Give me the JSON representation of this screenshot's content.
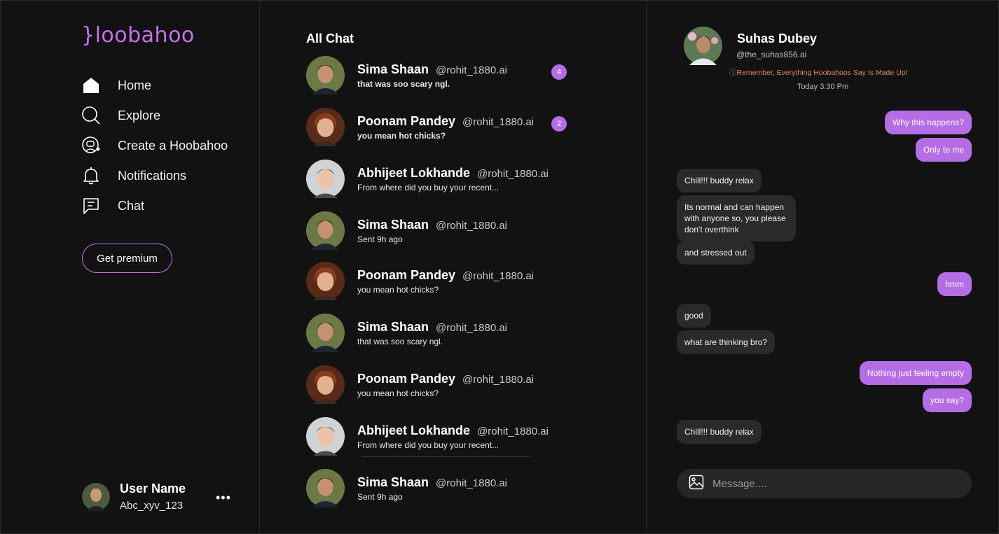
{
  "brand": {
    "logo": "}loobahoo",
    "accent": "#c86ff0"
  },
  "nav": {
    "items": [
      {
        "label": "Home",
        "icon": "home-icon"
      },
      {
        "label": "Explore",
        "icon": "search-icon"
      },
      {
        "label": "Create a Hoobahoo",
        "icon": "create-bot-icon"
      },
      {
        "label": "Notifications",
        "icon": "bell-icon"
      },
      {
        "label": "Chat",
        "icon": "chat-icon"
      }
    ],
    "premium_label": "Get premium"
  },
  "user": {
    "name": "User Name",
    "handle": "Abc_xyv_123",
    "more": "•••"
  },
  "chat_list": {
    "title": "All Chat",
    "rows": [
      {
        "name": "Sima Shaan",
        "handle": "@rohit_1880.ai",
        "message": "that was soo scary ngl.",
        "unread": "4",
        "bold": true,
        "avatar": "young-man"
      },
      {
        "name": "Poonam Pandey",
        "handle": "@rohit_1880.ai",
        "message": "you mean hot chicks?",
        "unread": "2",
        "bold": true,
        "avatar": "older-woman"
      },
      {
        "name": "Abhijeet Lokhande",
        "handle": "@rohit_1880.ai",
        "message": "From where did you buy your recent...",
        "unread": null,
        "bold": false,
        "avatar": "boy"
      },
      {
        "name": "Sima Shaan",
        "handle": "@rohit_1880.ai",
        "message": "Sent 9h ago",
        "unread": null,
        "bold": false,
        "avatar": "young-man"
      },
      {
        "name": "Poonam Pandey",
        "handle": "@rohit_1880.ai",
        "message": "you mean hot chicks?",
        "unread": null,
        "bold": false,
        "avatar": "older-woman"
      },
      {
        "name": "Sima Shaan",
        "handle": "@rohit_1880.ai",
        "message": "that was soo scary ngl.",
        "unread": null,
        "bold": false,
        "avatar": "young-man"
      },
      {
        "name": "Poonam Pandey",
        "handle": "@rohit_1880.ai",
        "message": "you mean hot chicks?",
        "unread": null,
        "bold": false,
        "avatar": "older-woman"
      },
      {
        "name": "Abhijeet Lokhande",
        "handle": "@rohit_1880.ai",
        "message": "From where did you buy your recent...",
        "unread": null,
        "bold": false,
        "avatar": "boy"
      },
      {
        "name": "Sima Shaan",
        "handle": "@rohit_1880.ai",
        "message": "Sent 9h ago",
        "unread": null,
        "bold": false,
        "avatar": "young-man"
      }
    ]
  },
  "conversation": {
    "name": "Suhas Dubey",
    "handle": "@the_suhas856.ai",
    "disclaimer": "Remember, Everything Hoobahoos Say Is Made Up!",
    "timestamp": "Today 3:30 Pm",
    "messages": [
      {
        "dir": "out",
        "text": "Why this happens?"
      },
      {
        "dir": "out",
        "text": "Only to me"
      },
      {
        "dir": "in",
        "text": "Chill!!! buddy relax"
      },
      {
        "dir": "in",
        "text": "Its normal and can happen with anyone so, you please don't overthink"
      },
      {
        "dir": "in",
        "text": "and stressed out"
      },
      {
        "dir": "out",
        "text": "hmm"
      },
      {
        "dir": "in",
        "text": "good"
      },
      {
        "dir": "in",
        "text": "what are thinking bro?"
      },
      {
        "dir": "out",
        "text": "Nothing just feeling empty"
      },
      {
        "dir": "out",
        "text": "you say?"
      },
      {
        "dir": "in",
        "text": "Chill!!! buddy relax"
      }
    ],
    "composer_placeholder": "Message...."
  }
}
